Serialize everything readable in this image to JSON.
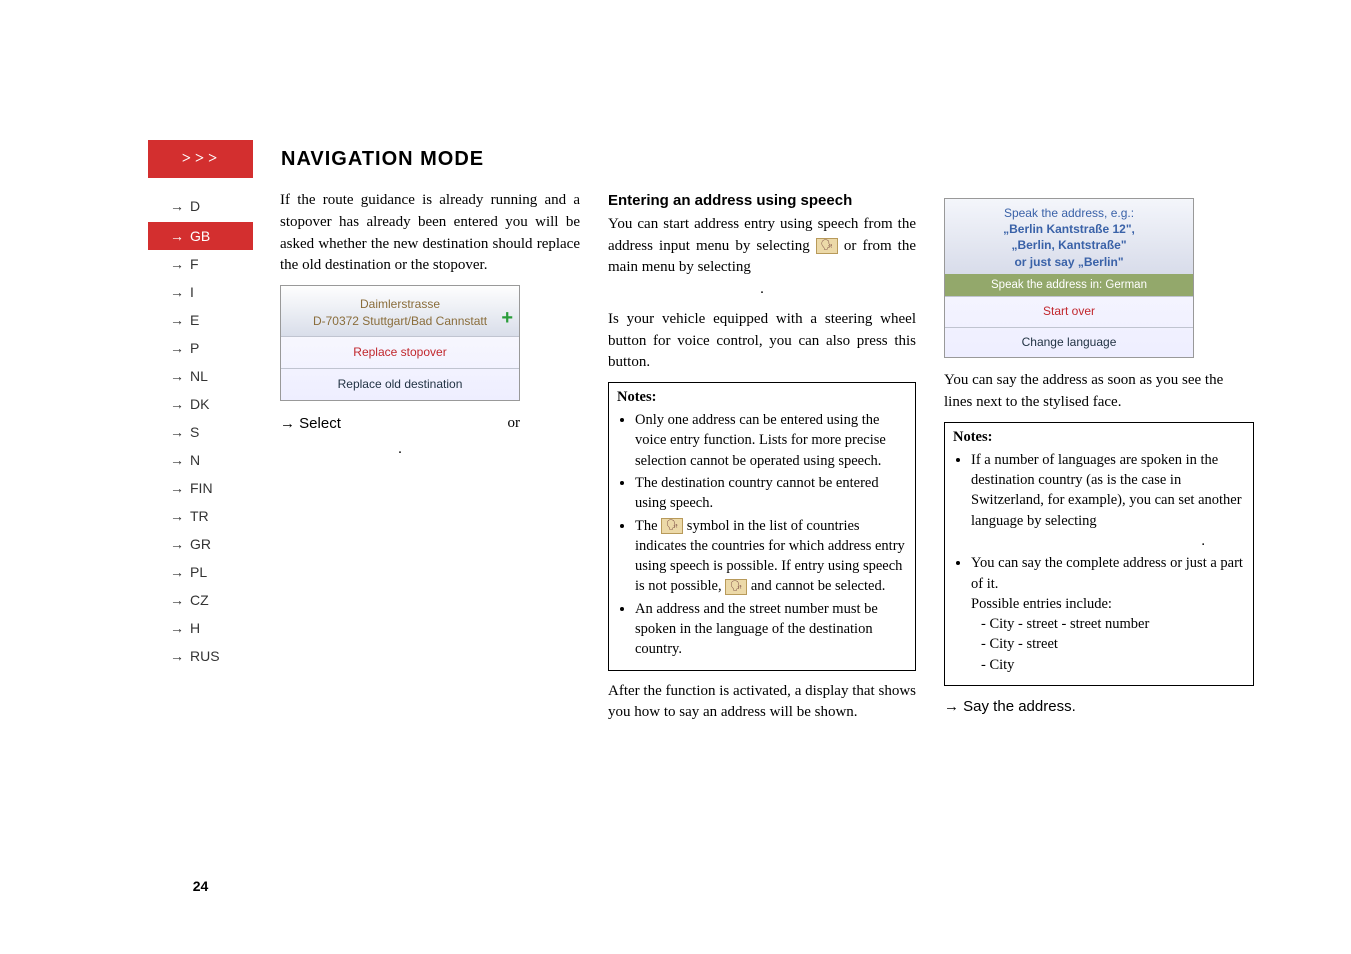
{
  "header": {
    "arrows": "→→→",
    "title": "NAVIGATION MODE"
  },
  "sidebar": {
    "items": [
      {
        "label": "D"
      },
      {
        "label": "GB"
      },
      {
        "label": "F"
      },
      {
        "label": "I"
      },
      {
        "label": "E"
      },
      {
        "label": "P"
      },
      {
        "label": "NL"
      },
      {
        "label": "DK"
      },
      {
        "label": "S"
      },
      {
        "label": "N"
      },
      {
        "label": "FIN"
      },
      {
        "label": "TR"
      },
      {
        "label": "GR"
      },
      {
        "label": "PL"
      },
      {
        "label": "CZ"
      },
      {
        "label": "H"
      },
      {
        "label": "RUS"
      }
    ]
  },
  "page_number": "24",
  "col1": {
    "intro": "If the route guidance is already running and a stopover has already been entered you will be asked whether the new destination should replace the old destination or the stopover.",
    "screenshot": {
      "line1": "Daimlerstrasse",
      "line2": "D-70372 Stuttgart/Bad Cannstatt",
      "opt1": "Replace stopover",
      "opt2": "Replace old destination"
    },
    "select_prefix": "→ Select",
    "select_or": "or",
    "select_period": "."
  },
  "col2": {
    "heading": "Entering an address using speech",
    "p1a": "You can start address entry using speech from the address input menu by selecting ",
    "p1b": " or from the main menu by selecting ",
    "p1c": ".",
    "p2": "Is your vehicle equipped with a steering wheel button for voice control, you can also press this button.",
    "notes_title": "Notes:",
    "note1": "Only one address can be entered using the voice entry function. Lists for more precise selection cannot be operated using speech.",
    "note2": "The destination country cannot be entered using speech.",
    "note3a": "The ",
    "note3b": " symbol in the list of countries indicates the countries for which address entry using speech is possible. If entry using speech is not possible, ",
    "note3c": " and ",
    "note3d": " cannot be selected.",
    "note4": "An address and the street number must be spoken in the language of the destination country.",
    "after": "After the function is activated, a display that shows you how to say an address will be shown."
  },
  "col3": {
    "screenshot": {
      "line1": "Speak the address, e.g.:",
      "line2": "„Berlin Kantstraße 12\",",
      "line3": "„Berlin, Kantstraße\"",
      "line4": "or just say „Berlin\"",
      "greenbar": "Speak the address in: German",
      "opt1": "Start over",
      "opt2": "Change language"
    },
    "p1": "You can say the address as soon as you see the lines next to the stylised face.",
    "notes_title": "Notes:",
    "note1": "If a number of languages are spoken in the destination country (as is the case in Switzerland, for example), you can set another language by selecting",
    "note1_period": ".",
    "note2": "You can say the complete address or just a part of it.",
    "note2b": "Possible entries include:",
    "sub1": "- City - street - street number",
    "sub2": "- City - street",
    "sub3": "- City",
    "say": "→ Say the address."
  }
}
